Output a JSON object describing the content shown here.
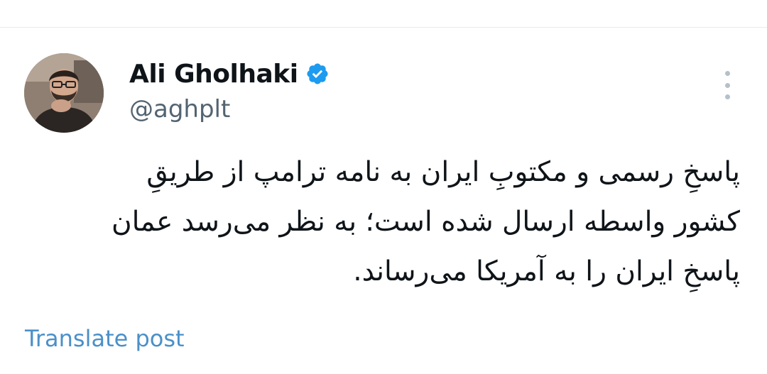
{
  "post": {
    "author": {
      "display_name": "Ali Gholhaki",
      "handle": "@aghplt",
      "verified": true,
      "avatar_icon": "profile-photo"
    },
    "more_icon": "vertical-ellipsis-icon",
    "text_lines": [
      "پاسخِ رسمی و مکتوبِ ایران به نامه ترامپ از طریقِ",
      "کشور واسطه ارسال شده است؛ به نظر می‌رسد عمان",
      "پاسخِ ایران را به آمریکا می‌رساند."
    ],
    "translate_label": "Translate post"
  },
  "colors": {
    "verified": "#1d9bf0",
    "link": "#4a90c9",
    "secondary_text": "#536471",
    "primary_text": "#0f1419"
  }
}
